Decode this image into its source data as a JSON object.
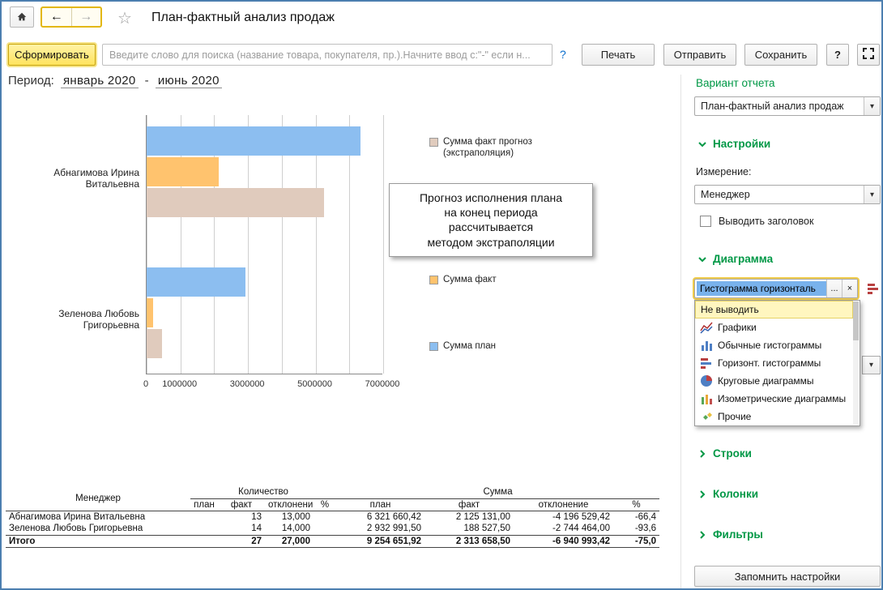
{
  "window": {
    "title": "План-фактный анализ продаж"
  },
  "icons": {
    "back": "←",
    "forward": "→",
    "star": "☆",
    "dropdown_arrow": "▾"
  },
  "toolbar": {
    "generate": "Сформировать",
    "search_placeholder": "Введите слово для поиска (название товара, покупателя, пр.).Начните ввод с:\"-\" если н...",
    "help_link": "?",
    "print": "Печать",
    "send": "Отправить",
    "save": "Сохранить",
    "question": "?"
  },
  "period": {
    "label": "Период:",
    "from": "январь 2020",
    "dash": "-",
    "to": "июнь 2020"
  },
  "callout": {
    "lines": [
      "Прогноз исполнения плана",
      "на конец периода",
      "рассчитывается",
      "методом экстраполяции"
    ]
  },
  "chart_data": {
    "type": "bar",
    "orientation": "horizontal",
    "categories": [
      "Абнагимова Ирина Витальевна",
      "Зеленова Любовь Григорьевна"
    ],
    "series": [
      {
        "name": "Сумма план",
        "color": "#8CBEF0",
        "values": [
          6321660,
          2932992
        ]
      },
      {
        "name": "Сумма факт",
        "color": "#FFC36E",
        "values": [
          2125131,
          188528
        ]
      },
      {
        "name": "Сумма факт прогноз (экстраполяция)",
        "color": "#E0CBBD",
        "values": [
          5250000,
          450000
        ]
      }
    ],
    "xlim": [
      0,
      7000000
    ],
    "grid_step": 1000000,
    "xticks": [
      0,
      1000000,
      3000000,
      5000000,
      7000000
    ],
    "grid": true,
    "legend_position": "right",
    "legend_order": [
      "Сумма факт прогноз (экстраполяция)",
      "Сумма факт",
      "Сумма план"
    ]
  },
  "table": {
    "col_manager": "Менеджер",
    "group_quantity": "Количество",
    "group_sum": "Сумма",
    "sub": {
      "plan": "план",
      "fact": "факт",
      "dev": "отклонение",
      "pct": "%"
    },
    "rows": [
      {
        "manager": "Абнагимова Ирина Витальевна",
        "qty_plan": "",
        "qty_fact": "13",
        "qty_dev": "13,000",
        "qty_pct": "",
        "sum_plan": "6 321 660,42",
        "sum_fact": "2 125 131,00",
        "sum_dev": "-4 196 529,42",
        "sum_pct": "-66,4"
      },
      {
        "manager": "Зеленова Любовь Григорьевна",
        "qty_plan": "",
        "qty_fact": "14",
        "qty_dev": "14,000",
        "qty_pct": "",
        "sum_plan": "2 932 991,50",
        "sum_fact": "188 527,50",
        "sum_dev": "-2 744 464,00",
        "sum_pct": "-93,6"
      }
    ],
    "total": {
      "manager": "Итого",
      "qty_plan": "",
      "qty_fact": "27",
      "qty_dev": "27,000",
      "qty_pct": "",
      "sum_plan": "9 254 651,92",
      "sum_fact": "2 313 658,50",
      "sum_dev": "-6 940 993,42",
      "sum_pct": "-75,0"
    }
  },
  "sidebar": {
    "report_variant_header": "Вариант отчета",
    "report_variant_value": "План-фактный анализ продаж",
    "settings_header": "Настройки",
    "dimension_label": "Измерение:",
    "dimension_value": "Менеджер",
    "show_title_checkbox": "Выводить заголовок",
    "diagram_header": "Диаграмма",
    "diagram_value": "Гистограмма горизонталь",
    "diagram_ellipsis": "...",
    "diagram_clear": "×",
    "dropdown_items": [
      {
        "label": "Не выводить",
        "icon": "no-icon",
        "selected": true
      },
      {
        "label": "Графики",
        "icon": "line-chart-icon"
      },
      {
        "label": "Обычные гистограммы",
        "icon": "bar-chart-icon"
      },
      {
        "label": "Горизонт. гистограммы",
        "icon": "hbar-chart-icon"
      },
      {
        "label": "Круговые диаграммы",
        "icon": "pie-chart-icon"
      },
      {
        "label": "Изометрические диаграммы",
        "icon": "iso-chart-icon"
      },
      {
        "label": "Прочие",
        "icon": "other-chart-icon"
      }
    ],
    "rows_header": "Строки",
    "columns_header": "Колонки",
    "filters_header": "Фильтры",
    "remember_button": "Запомнить настройки"
  }
}
